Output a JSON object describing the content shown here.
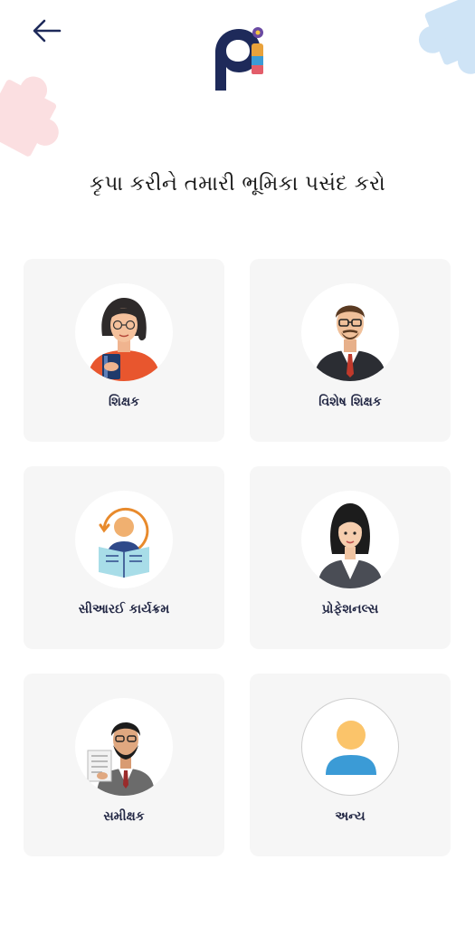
{
  "header": {
    "back_icon": "arrow-left-icon",
    "logo_text": "pi"
  },
  "title": "કૃપા કરીને તમારી ભૂમિકા પસંદ કરો",
  "roles": [
    {
      "label": "શિક્ષક",
      "icon": "teacher-female-avatar-icon"
    },
    {
      "label": "વિશેષ શિક્ષક",
      "icon": "special-teacher-male-avatar-icon"
    },
    {
      "label": "સીઆરઈ કાર્યક્રમ",
      "icon": "reading-person-icon"
    },
    {
      "label": "પ્રોફેશનલ્સ",
      "icon": "professional-female-avatar-icon"
    },
    {
      "label": "સમીક્ષક",
      "icon": "reviewer-male-avatar-icon"
    },
    {
      "label": "અન્ય",
      "icon": "user-icon"
    }
  ],
  "colors": {
    "card_bg": "#f6f6f6",
    "label": "#222744",
    "puzzle_pink": "#fbdfe1",
    "puzzle_blue": "#cfe4f6",
    "logo_navy": "#1e2a5a",
    "user_icon_face": "#fbc46a",
    "user_icon_body": "#3b9bd6"
  }
}
